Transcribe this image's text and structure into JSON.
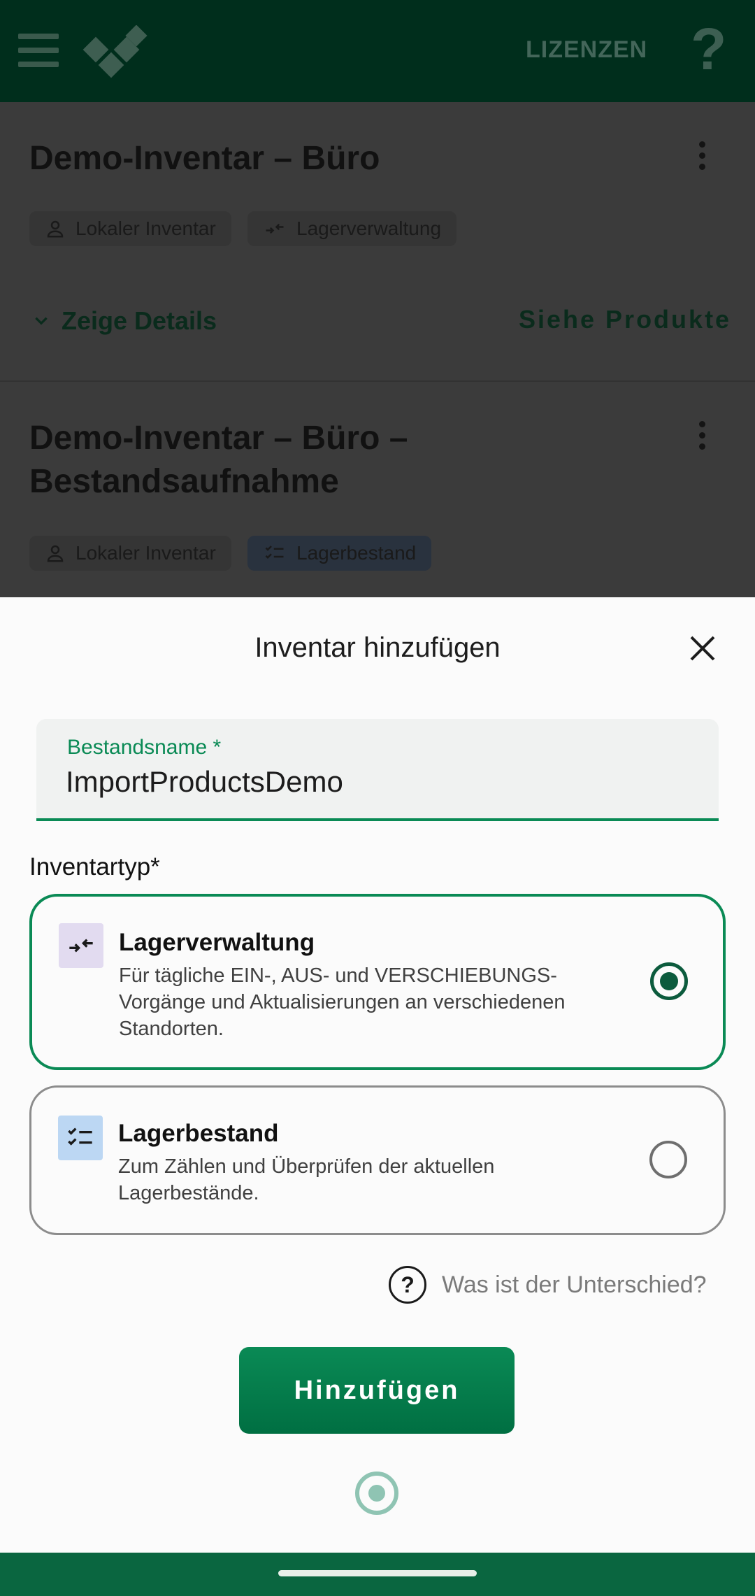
{
  "appbar": {
    "licenses_label": "LIZENZEN",
    "help_label": "?"
  },
  "inventories": [
    {
      "title": "Demo-Inventar – Büro",
      "chips": [
        "Lokaler Inventar",
        "Lagerverwaltung"
      ],
      "details_label": "Zeige Details",
      "products_label": "Siehe Produkte"
    },
    {
      "title_line1": "Demo-Inventar – Büro –",
      "title_line2": "Bestandsaufnahme",
      "chips": [
        "Lokaler Inventar",
        "Lagerbestand"
      ]
    }
  ],
  "dialog": {
    "title": "Inventar hinzufügen",
    "name_field": {
      "label": "Bestandsname *",
      "value": "ImportProductsDemo"
    },
    "type_label": "Inventartyp*",
    "options": [
      {
        "title": "Lagerverwaltung",
        "description": "Für tägliche EIN-, AUS- und VERSCHIEBUNGS-Vorgänge und Aktualisierungen an verschiedenen Standorten.",
        "selected": true
      },
      {
        "title": "Lagerbestand",
        "description": "Zum Zählen und Überprüfen der aktuellen Lagerbestände.",
        "selected": false
      }
    ],
    "difference_icon": "?",
    "difference_label": "Was ist der Unterschied?",
    "add_button": "Hinzufügen"
  },
  "colors": {
    "accent": "#0a8a55",
    "appbar": "#002e1c",
    "navbar": "#0a6640"
  }
}
